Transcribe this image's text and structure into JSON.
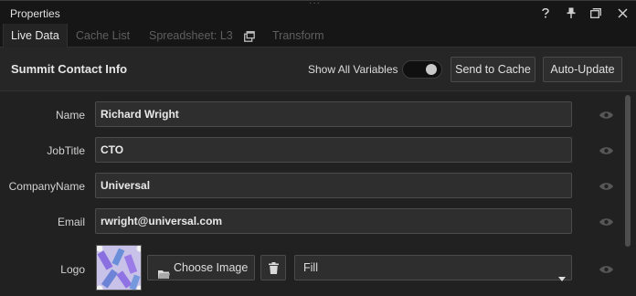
{
  "window": {
    "title": "Properties",
    "controls": [
      "help-icon",
      "pin-icon",
      "restore-window-icon",
      "close-icon"
    ]
  },
  "tabs": [
    {
      "label": "Live Data",
      "active": true
    },
    {
      "label": "Cache List",
      "active": false
    },
    {
      "label": "Spreadsheet: L3",
      "active": false,
      "icon": "popout-icon"
    },
    {
      "label": "Transform",
      "active": false
    }
  ],
  "header": {
    "title": "Summit Contact Info",
    "toggle_label": "Show All Variables",
    "toggle_on": true,
    "send_label": "Send to Cache",
    "auto_label": "Auto-Update"
  },
  "fields": [
    {
      "label": "Name",
      "value": "Richard Wright",
      "icon": "eye-icon"
    },
    {
      "label": "JobTitle",
      "value": "CTO",
      "icon": "eye-icon"
    },
    {
      "label": "CompanyName",
      "value": "Universal",
      "icon": "eye-icon"
    },
    {
      "label": "Email",
      "value": "rwright@universal.com",
      "icon": "eye-icon"
    }
  ],
  "logo": {
    "label": "Logo",
    "choose_label": "Choose Image",
    "fit_value": "Fill",
    "icons": [
      "folder-icon",
      "trash-icon",
      "chevron-down-icon",
      "eye-icon"
    ]
  },
  "colors": {
    "background": "#1c1c1c",
    "panel": "#212121",
    "field": "#2e2e2e",
    "border": "#4b4b4b",
    "text": "#d8d8d8",
    "tab_inactive": "#5f5f5f"
  }
}
